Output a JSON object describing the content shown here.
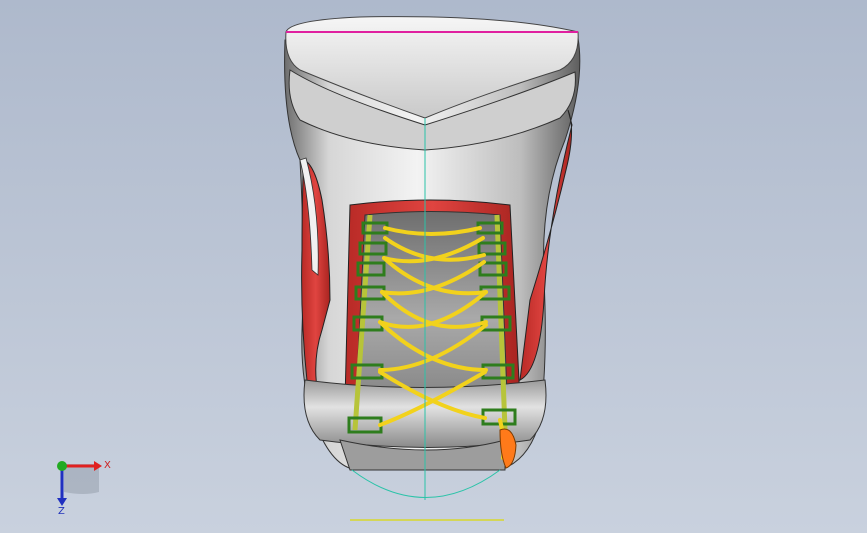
{
  "viewport": {
    "model": "boot-lacing-assembly",
    "background_top": "#aeb9cc",
    "background_bottom": "#c9d1de"
  },
  "triad": {
    "x_label": "X",
    "z_label": "Z",
    "x_color": "#e02020",
    "y_color": "#22aa22",
    "z_color": "#2030c0"
  },
  "model_colors": {
    "shell": "#e6e6e6",
    "accent": "#d93a36",
    "lace": "#f2d21c",
    "eyelet": "#2e7d1d",
    "tag": "#ff7a1a"
  }
}
